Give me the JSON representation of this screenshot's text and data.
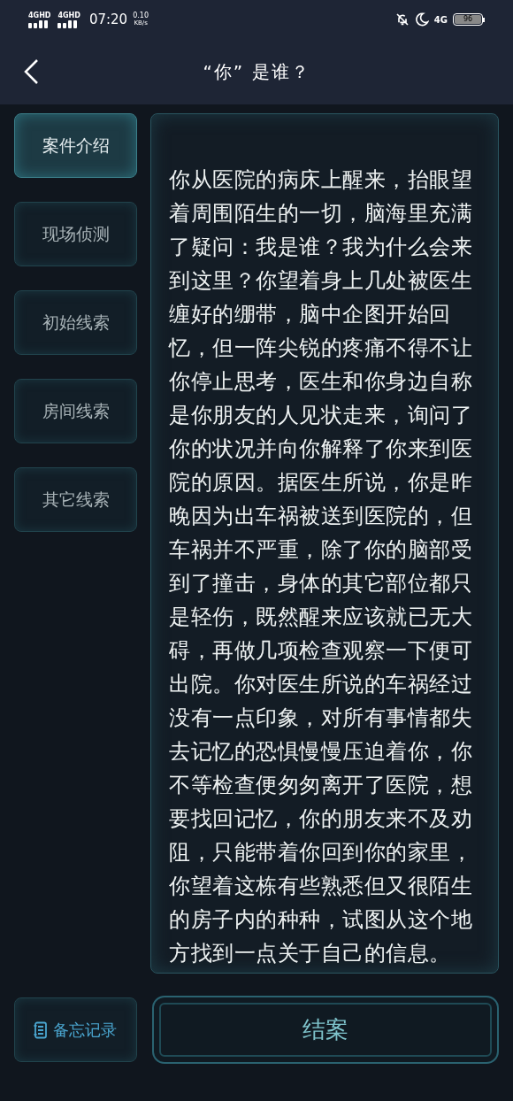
{
  "status_bar": {
    "networks": [
      "4GHD",
      "4GHD"
    ],
    "time": "07:20",
    "speed": "0.10",
    "speed_unit": "KB/s",
    "network_type": "4G",
    "battery": "96"
  },
  "header": {
    "title": "“你” 是谁？"
  },
  "tabs": [
    {
      "label": "案件介绍",
      "selected": true
    },
    {
      "label": "现场侦测",
      "selected": false
    },
    {
      "label": "初始线索",
      "selected": false
    },
    {
      "label": "房间线索",
      "selected": false
    },
    {
      "label": "其它线索",
      "selected": false
    }
  ],
  "content": {
    "text": "你从医院的病床上醒来，抬眼望着周围陌生的一切，脑海里充满了疑问：我是谁？我为什么会来到这里？你望着身上几处被医生缠好的绷带，脑中企图开始回忆，但一阵尖锐的疼痛不得不让你停止思考，医生和你身边自称是你朋友的人见状走来，询问了你的状况并向你解释了你来到医院的原因。据医生所说，你是昨晚因为出车祸被送到医院的，但车祸并不严重，除了你的脑部受到了撞击，身体的其它部位都只是轻伤，既然醒来应该就已无大碍，再做几项检查观察一下便可出院。你对医生所说的车祸经过没有一点印象，对所有事情都失去记忆的恐惧慢慢压迫着你，你不等检查便匆匆离开了医院，想要找回记忆，你的朋友来不及劝阻，只能带着你回到你的家里，你望着这栋有些熟悉但又很陌生的房子内的种种，试图从这个地方找到一点关于自己的信息。"
  },
  "footer": {
    "memo_button": "备忘记录",
    "close_case_button": "结案"
  }
}
